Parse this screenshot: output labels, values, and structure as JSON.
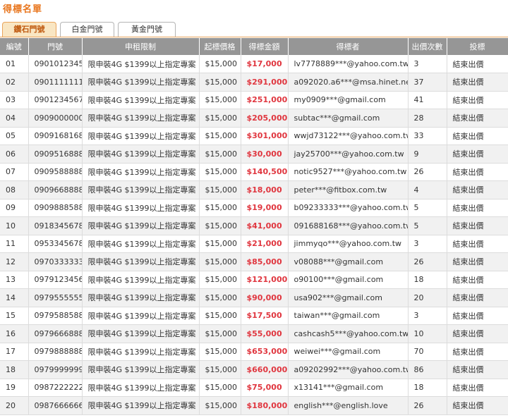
{
  "page": {
    "title": "得標名單"
  },
  "tabs": [
    {
      "label": "鑽石門號",
      "active": true
    },
    {
      "label": "白金門號",
      "active": false
    },
    {
      "label": "黃金門號",
      "active": false
    }
  ],
  "table": {
    "headers": [
      "編號",
      "門號",
      "申租限制",
      "起標價格",
      "得標金額",
      "得標者",
      "出價次數",
      "投標"
    ],
    "rows": [
      [
        "01",
        "0901012345",
        "限申裝4G $1399以上指定專案",
        "$15,000",
        "$17,000",
        "lv7778889***@yahoo.com.tw",
        "3",
        "結束出價"
      ],
      [
        "02",
        "0901111111",
        "限申裝4G $1399以上指定專案",
        "$15,000",
        "$291,000",
        "a092020.a6***@msa.hinet.net",
        "37",
        "結束出價"
      ],
      [
        "03",
        "0901234567",
        "限申裝4G $1399以上指定專案",
        "$15,000",
        "$251,000",
        "my0909***@gmail.com",
        "41",
        "結束出價"
      ],
      [
        "04",
        "0909000000",
        "限申裝4G $1399以上指定專案",
        "$15,000",
        "$205,000",
        "subtac***@gmail.com",
        "28",
        "結束出價"
      ],
      [
        "05",
        "0909168168",
        "限申裝4G $1399以上指定專案",
        "$15,000",
        "$301,000",
        "wwjd73122***@yahoo.com.tw",
        "33",
        "結束出價"
      ],
      [
        "06",
        "0909516888",
        "限申裝4G $1399以上指定專案",
        "$15,000",
        "$30,000",
        "jay25700***@yahoo.com.tw",
        "9",
        "結束出價"
      ],
      [
        "07",
        "0909588888",
        "限申裝4G $1399以上指定專案",
        "$15,000",
        "$140,500",
        "notic9527***@yahoo.com.tw",
        "26",
        "結束出價"
      ],
      [
        "08",
        "0909668888",
        "限申裝4G $1399以上指定專案",
        "$15,000",
        "$18,000",
        "peter***@fitbox.com.tw",
        "4",
        "結束出價"
      ],
      [
        "09",
        "0909888588",
        "限申裝4G $1399以上指定專案",
        "$15,000",
        "$19,000",
        "b09233333***@yahoo.com.tw",
        "5",
        "結束出價"
      ],
      [
        "10",
        "0918345678",
        "限申裝4G $1399以上指定專案",
        "$15,000",
        "$41,000",
        "091688168***@yahoo.com.tw",
        "5",
        "結束出價"
      ],
      [
        "11",
        "0953345678",
        "限申裝4G $1399以上指定專案",
        "$15,000",
        "$21,000",
        "jimmyqo***@yahoo.com.tw",
        "3",
        "結束出價"
      ],
      [
        "12",
        "0970333333",
        "限申裝4G $1399以上指定專案",
        "$15,000",
        "$85,000",
        "v08088***@gmail.com",
        "26",
        "結束出價"
      ],
      [
        "13",
        "0979123456",
        "限申裝4G $1399以上指定專案",
        "$15,000",
        "$121,000",
        "o90100***@gmail.com",
        "18",
        "結束出價"
      ],
      [
        "14",
        "0979555555",
        "限申裝4G $1399以上指定專案",
        "$15,000",
        "$90,000",
        "usa902***@gmail.com",
        "20",
        "結束出價"
      ],
      [
        "15",
        "0979588588",
        "限申裝4G $1399以上指定專案",
        "$15,000",
        "$17,500",
        "taiwan***@gmail.com",
        "3",
        "結束出價"
      ],
      [
        "16",
        "0979666888",
        "限申裝4G $1399以上指定專案",
        "$15,000",
        "$55,000",
        "cashcash5***@yahoo.com.tw",
        "10",
        "結束出價"
      ],
      [
        "17",
        "0979888888",
        "限申裝4G $1399以上指定專案",
        "$15,000",
        "$653,000",
        "weiwei***@gmail.com",
        "70",
        "結束出價"
      ],
      [
        "18",
        "0979999999",
        "限申裝4G $1399以上指定專案",
        "$15,000",
        "$660,000",
        "a09202992***@yahoo.com.tw",
        "86",
        "結束出價"
      ],
      [
        "19",
        "0987222222",
        "限申裝4G $1399以上指定專案",
        "$15,000",
        "$75,000",
        "x13141***@gmail.com",
        "18",
        "結束出價"
      ],
      [
        "20",
        "0987666666",
        "限申裝4G $1399以上指定專案",
        "$15,000",
        "$180,000",
        "english***@english.love",
        "26",
        "結束出價"
      ]
    ]
  },
  "colors": {
    "accent": "#e8761e",
    "active_tab_bg": "#f9e6c3",
    "header_bg": "#969696",
    "amount": "#e0363f",
    "row_alt": "#f1f1f1"
  }
}
